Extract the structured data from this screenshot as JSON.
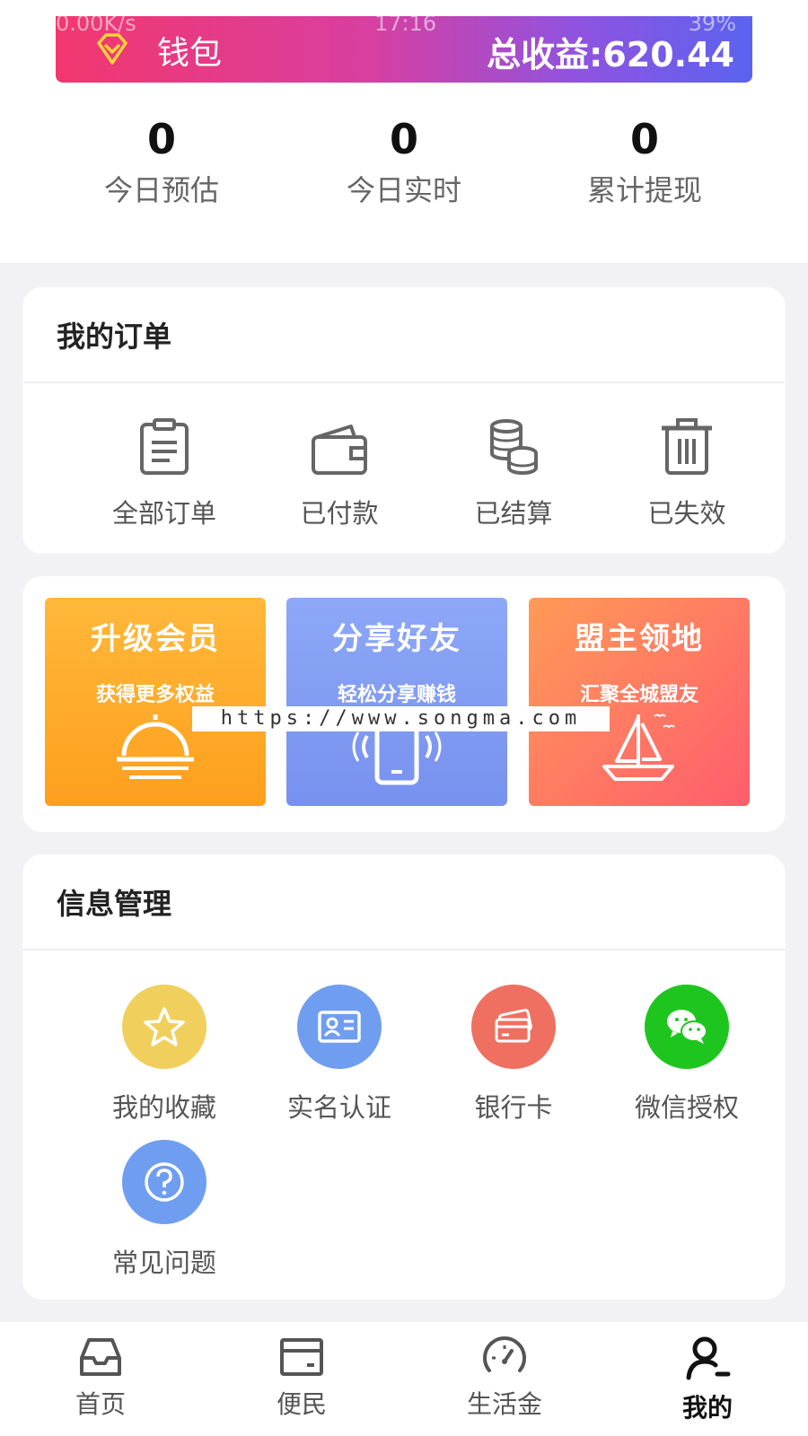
{
  "status_bar": {
    "speed": "0.00K/s",
    "time": "17:16",
    "battery": "39%"
  },
  "wallet": {
    "label": "钱包",
    "total": "总收益:620.44"
  },
  "stats": [
    {
      "value": "0",
      "label": "今日预估"
    },
    {
      "value": "0",
      "label": "今日实时"
    },
    {
      "value": "0",
      "label": "累计提现"
    }
  ],
  "orders": {
    "title": "我的订单",
    "items": [
      {
        "label": "全部订单",
        "icon": "clipboard-icon"
      },
      {
        "label": "已付款",
        "icon": "wallet-icon"
      },
      {
        "label": "已结算",
        "icon": "coins-icon"
      },
      {
        "label": "已失效",
        "icon": "trash-icon"
      }
    ]
  },
  "promos": [
    {
      "title": "升级会员",
      "subtitle": "获得更多权益",
      "icon": "sunrise-icon",
      "colors": [
        "#ffb02e",
        "#ff9a1f"
      ]
    },
    {
      "title": "分享好友",
      "subtitle": "轻松分享赚钱",
      "icon": "phone-icon",
      "colors": [
        "#7f9cf5",
        "#6f8ff0"
      ]
    },
    {
      "title": "盟主领地",
      "subtitle": "汇聚全城盟友",
      "icon": "sailboat-icon",
      "colors": [
        "#ff8a5c",
        "#ff5a6a"
      ]
    }
  ],
  "watermark": "https://www.songma.com",
  "info": {
    "title": "信息管理",
    "items": [
      {
        "label": "我的收藏",
        "icon": "star-icon",
        "color": "#f0cf5c"
      },
      {
        "label": "实名认证",
        "icon": "id-card-icon",
        "color": "#6f9ef0"
      },
      {
        "label": "银行卡",
        "icon": "bank-card-icon",
        "color": "#ef7060"
      },
      {
        "label": "微信授权",
        "icon": "wechat-icon",
        "color": "#1fc51f"
      },
      {
        "label": "常见问题",
        "icon": "question-icon",
        "color": "#6f9ef0"
      }
    ]
  },
  "nav": [
    {
      "label": "首页",
      "icon": "inbox-icon"
    },
    {
      "label": "便民",
      "icon": "card-icon"
    },
    {
      "label": "生活金",
      "icon": "gauge-icon"
    },
    {
      "label": "我的",
      "icon": "user-icon",
      "active": true
    }
  ]
}
